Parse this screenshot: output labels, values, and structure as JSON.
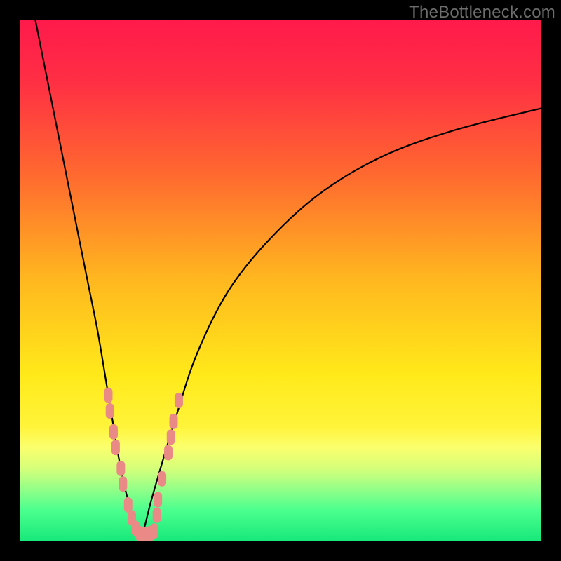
{
  "watermark": "TheBottleneck.com",
  "chart_data": {
    "type": "line",
    "title": "",
    "xlabel": "",
    "ylabel": "",
    "xlim": [
      0,
      100
    ],
    "ylim": [
      0,
      100
    ],
    "grid": false,
    "legend": false,
    "background_gradient_stops": [
      {
        "offset": 0.0,
        "color": "#ff1a4b"
      },
      {
        "offset": 0.12,
        "color": "#ff2f44"
      },
      {
        "offset": 0.3,
        "color": "#ff6a2f"
      },
      {
        "offset": 0.5,
        "color": "#ffb81f"
      },
      {
        "offset": 0.68,
        "color": "#ffe91a"
      },
      {
        "offset": 0.78,
        "color": "#fff43a"
      },
      {
        "offset": 0.82,
        "color": "#fbff6e"
      },
      {
        "offset": 0.86,
        "color": "#d6ff7a"
      },
      {
        "offset": 0.9,
        "color": "#93ff88"
      },
      {
        "offset": 0.94,
        "color": "#4bff8e"
      },
      {
        "offset": 1.0,
        "color": "#17e87a"
      }
    ],
    "series": [
      {
        "name": "left-branch",
        "x": [
          3,
          5,
          7,
          9,
          11,
          13,
          15,
          17,
          18,
          19,
          20,
          21,
          22,
          23
        ],
        "y": [
          100,
          90,
          80,
          70,
          60,
          50,
          40,
          28,
          22,
          16,
          11,
          7,
          3,
          0
        ]
      },
      {
        "name": "right-branch",
        "x": [
          23,
          24,
          25,
          27,
          30,
          34,
          40,
          48,
          58,
          70,
          84,
          100
        ],
        "y": [
          0,
          3,
          7,
          14,
          24,
          36,
          48,
          58,
          67,
          74,
          79,
          83
        ]
      }
    ],
    "markers": {
      "name": "salmon-dots",
      "color": "#e98a86",
      "points": [
        {
          "x": 17.0,
          "y": 28
        },
        {
          "x": 17.3,
          "y": 25
        },
        {
          "x": 18.0,
          "y": 21
        },
        {
          "x": 18.4,
          "y": 18
        },
        {
          "x": 19.4,
          "y": 14
        },
        {
          "x": 19.8,
          "y": 11
        },
        {
          "x": 20.8,
          "y": 7
        },
        {
          "x": 21.5,
          "y": 4.5
        },
        {
          "x": 22.2,
          "y": 2.5
        },
        {
          "x": 23.0,
          "y": 1.5
        },
        {
          "x": 24.0,
          "y": 1.3
        },
        {
          "x": 25.0,
          "y": 1.5
        },
        {
          "x": 25.8,
          "y": 2
        },
        {
          "x": 26.3,
          "y": 5
        },
        {
          "x": 26.5,
          "y": 8
        },
        {
          "x": 27.3,
          "y": 12
        },
        {
          "x": 28.5,
          "y": 17
        },
        {
          "x": 29.0,
          "y": 20
        },
        {
          "x": 29.5,
          "y": 23
        },
        {
          "x": 30.5,
          "y": 27
        }
      ]
    }
  }
}
